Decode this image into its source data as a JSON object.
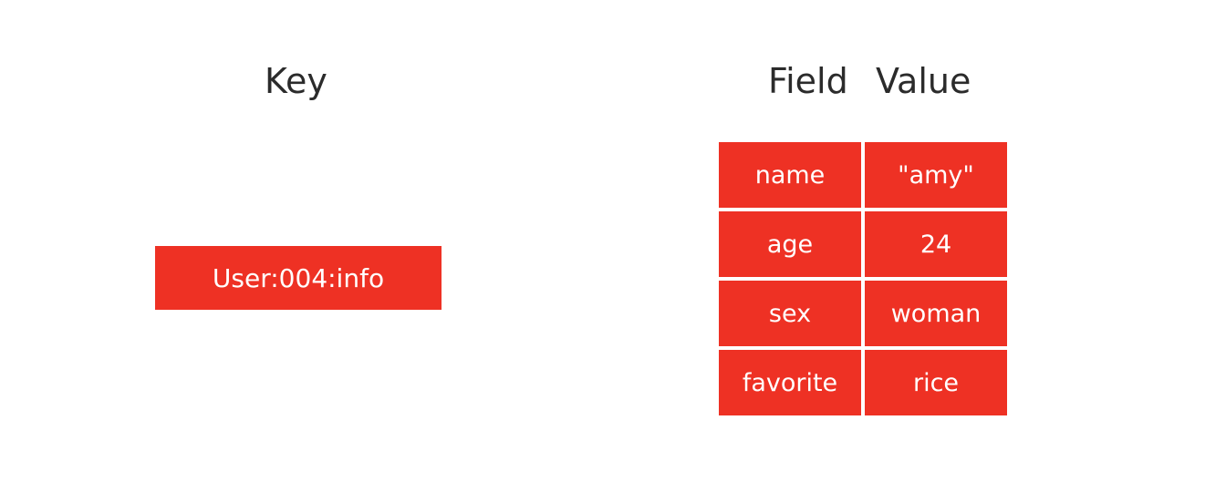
{
  "headings": {
    "key": "Key",
    "field": "Field",
    "value": "Value"
  },
  "key": {
    "label": "User:004:info"
  },
  "hash": {
    "rows": [
      {
        "field": "name",
        "value": "\"amy\""
      },
      {
        "field": "age",
        "value": "24"
      },
      {
        "field": "sex",
        "value": "woman"
      },
      {
        "field": "favorite",
        "value": "rice"
      }
    ]
  },
  "colors": {
    "cell_fill": "#ee3124",
    "cell_text": "#ffffff",
    "heading_text": "#2b2b2b",
    "background": "#ffffff"
  }
}
